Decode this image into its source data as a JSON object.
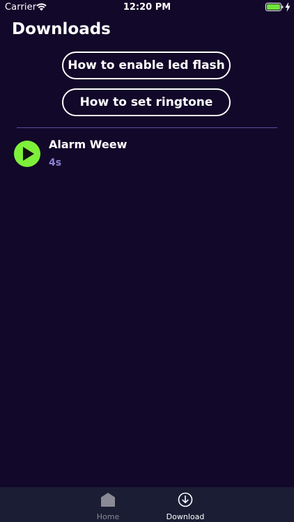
{
  "status_bar": {
    "carrier": "Carrier",
    "time": "12:20 PM",
    "battery_color": "#6fe33a"
  },
  "page": {
    "title": "Downloads"
  },
  "buttons": {
    "led_flash": "How to enable led flash",
    "ringtone": "How to set ringtone"
  },
  "downloads": [
    {
      "title": "Alarm Weew",
      "duration": "4s",
      "icon": "play-icon"
    }
  ],
  "tab_bar": {
    "tabs": [
      {
        "label": "Home",
        "icon": "home-icon",
        "active": false
      },
      {
        "label": "Download",
        "icon": "download-icon",
        "active": true
      }
    ]
  },
  "colors": {
    "background": "#120829",
    "accent_green": "#7ef03a",
    "duration_text": "#8a83d6",
    "tab_bar": "#1b1d34"
  }
}
